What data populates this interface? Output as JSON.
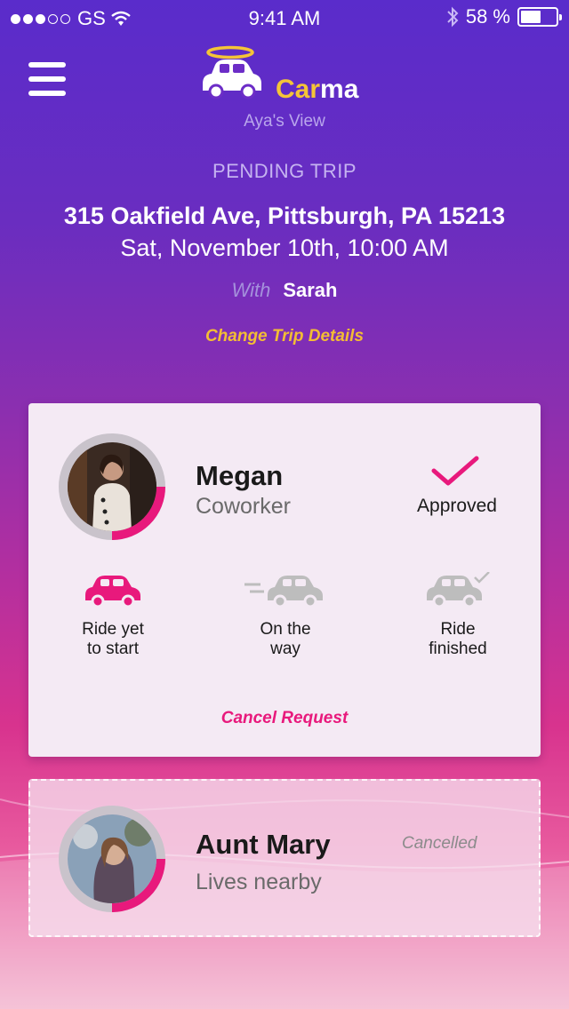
{
  "status_bar": {
    "carrier": "GS",
    "time": "9:41 AM",
    "battery": "58 %",
    "battery_level": 0.58,
    "icons": [
      "signal-dots-icon",
      "wifi-icon",
      "bluetooth-icon",
      "battery-icon"
    ]
  },
  "header": {
    "menu_icon": "hamburger-menu-icon",
    "logo_icon": "car-with-halo-icon",
    "brand_part1": "Car",
    "brand_part2": "ma",
    "view_label": "Aya's View"
  },
  "trip": {
    "status": "PENDING TRIP",
    "address": "315 Oakfield Ave, Pittsburgh, PA 15213",
    "datetime": "Sat, November 10th, 10:00 AM",
    "with_label": "With",
    "with_name": "Sarah",
    "change_link": "Change Trip Details"
  },
  "requests": [
    {
      "name": "Megan",
      "relation": "Coworker",
      "status": "Approved",
      "status_icon": "checkmark-icon",
      "stages": [
        {
          "label": "Ride yet\nto start",
          "icon": "car-icon",
          "active": true
        },
        {
          "label": "On the\nway",
          "icon": "car-moving-icon",
          "active": false
        },
        {
          "label": "Ride\nfinished",
          "icon": "car-check-icon",
          "active": false
        }
      ],
      "cancel_link": "Cancel Request"
    },
    {
      "name": "Aunt Mary",
      "relation": "Lives nearby",
      "status": "Cancelled"
    }
  ],
  "colors": {
    "accent_pink": "#e8197c",
    "accent_yellow": "#f3bd34",
    "inactive_gray": "#bdbdbd"
  }
}
